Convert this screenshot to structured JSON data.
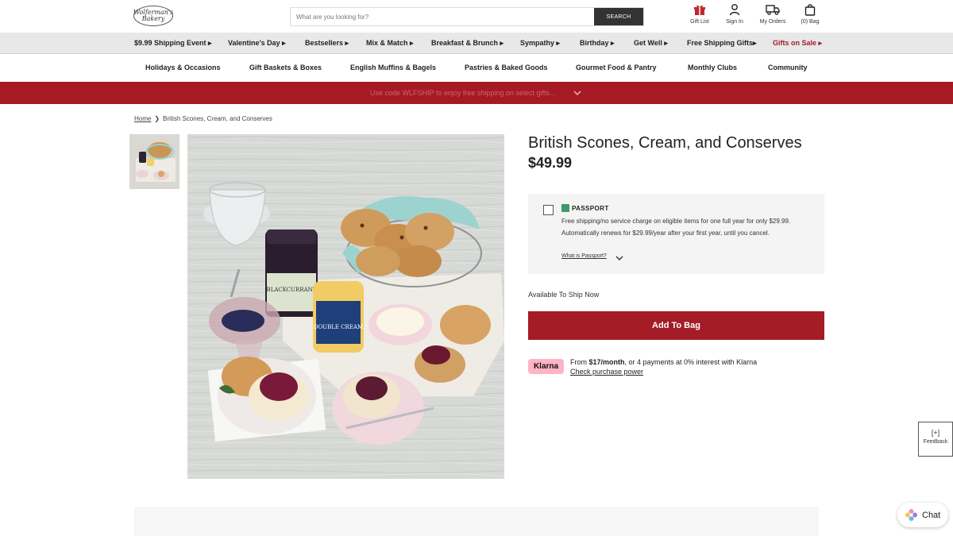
{
  "header": {
    "logo_line1": "Wolferman's",
    "logo_line2": "Bakery",
    "search_placeholder": "What are you looking for?",
    "search_button": "SEARCH",
    "icons": [
      {
        "name": "gift-list",
        "label": "Gift List"
      },
      {
        "name": "sign-in",
        "label": "Sign In"
      },
      {
        "name": "my-orders",
        "label": "My Orders"
      },
      {
        "name": "bag",
        "label": "(0) Bag"
      }
    ]
  },
  "top_nav": [
    {
      "label": "$9.99 Shipping Event ▸"
    },
    {
      "label": "Valentine's Day ▸"
    },
    {
      "label": "Bestsellers ▸"
    },
    {
      "label": "Mix & Match ▸"
    },
    {
      "label": "Breakfast & Brunch ▸"
    },
    {
      "label": "Sympathy ▸"
    },
    {
      "label": "Birthday ▸"
    },
    {
      "label": "Get Well ▸"
    },
    {
      "label": "Free Shipping Gifts▸"
    },
    {
      "label": "Gifts on Sale ▸"
    }
  ],
  "category_nav": [
    {
      "label": "Holidays & Occasions"
    },
    {
      "label": "Gift Baskets & Boxes"
    },
    {
      "label": "English Muffins & Bagels"
    },
    {
      "label": "Pastries & Baked Goods"
    },
    {
      "label": "Gourmet Food & Pantry"
    },
    {
      "label": "Monthly Clubs"
    },
    {
      "label": "Community"
    }
  ],
  "promo": {
    "text": "Use code WLFSHIP to enjoy free shipping on select gifts..."
  },
  "breadcrumb": {
    "home": "Home",
    "separator": "❯",
    "current": "British Scones, Cream, and Conserves"
  },
  "product": {
    "title": "British Scones, Cream, and Conserves",
    "price": "$49.99",
    "availability": "Available To Ship Now",
    "add_to_bag": "Add To Bag"
  },
  "passport": {
    "brand": "PASSPORT",
    "description": "Free shipping/no service charge on eligible items for one full year for only $29.99. Automatically renews for $29.99/year after your first year, until you cancel.",
    "link": "What is Passport?"
  },
  "klarna": {
    "badge": "Klarna",
    "prefix": "From ",
    "amount": "$17/month",
    "suffix": ", or 4 payments at 0% interest with Klarna",
    "link": "Check purchase power"
  },
  "feedback": {
    "icon": "[+]",
    "label": "Feedback"
  },
  "chat": {
    "label": "Chat"
  },
  "colors": {
    "brand_red": "#a41c26",
    "klarna_pink": "#ffb3c7"
  }
}
